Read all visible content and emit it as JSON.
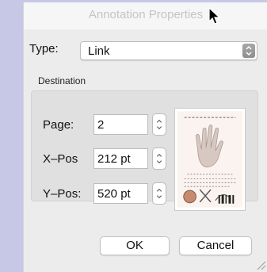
{
  "window": {
    "title": "Annotation Properties"
  },
  "type": {
    "label": "Type:",
    "value": "Link"
  },
  "destination": {
    "label": "Destination",
    "page": {
      "label": "Page:",
      "value": "2"
    },
    "xpos": {
      "label": "X–Pos",
      "value": "212 pt"
    },
    "ypos": {
      "label": "Y–Pos:",
      "value": "520 pt"
    }
  },
  "buttons": {
    "ok": "OK",
    "cancel": "Cancel"
  },
  "colors": {
    "background": "#c7c7e6",
    "panel": "#ececec",
    "group": "#e0e0e0"
  },
  "icons": [
    "mouse-pointer-icon",
    "popup-arrows-icon",
    "stepper-icon",
    "resize-grip-icon"
  ]
}
